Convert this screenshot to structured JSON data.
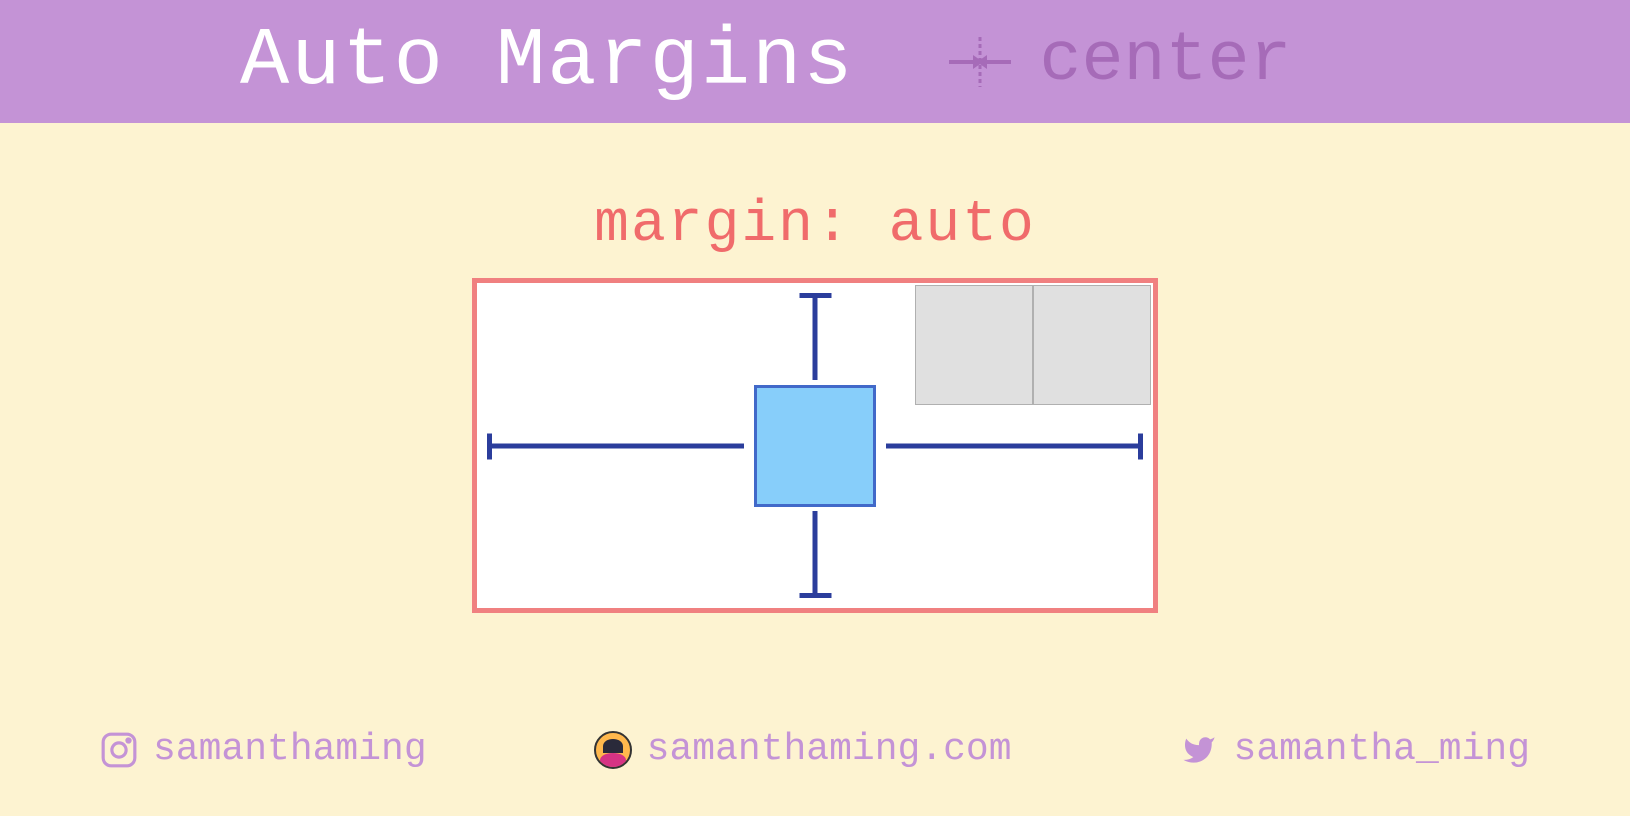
{
  "header": {
    "title": "Auto Margins",
    "subtitle": "center"
  },
  "diagram": {
    "code_label": "margin: auto"
  },
  "footer": {
    "instagram": "samanthaming",
    "website": "samanthaming.com",
    "twitter": "samantha_ming"
  },
  "colors": {
    "header_bg": "#c493d6",
    "page_bg": "#fdf3d1",
    "accent": "#f06b6b",
    "box_border": "#f08080",
    "square": "#87cefa",
    "arrow": "#2b3d9c"
  }
}
